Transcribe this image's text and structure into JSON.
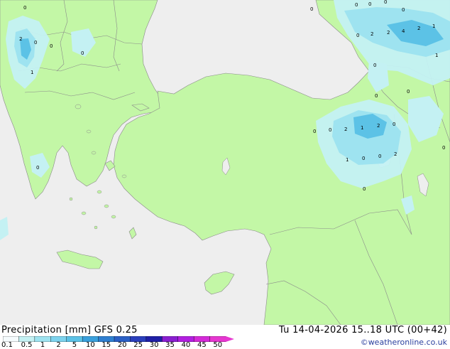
{
  "map": {
    "colors": {
      "sea": "#eeeeee",
      "land": "#c3f7a6",
      "border": "#8a8a8a",
      "precip_light": "#c4f1f3",
      "precip_mid": "#9ee3f0",
      "precip_heavy": "#5cc2e6"
    },
    "value_labels": [
      {
        "id": "v1",
        "text": "0"
      },
      {
        "id": "v2",
        "text": "2"
      },
      {
        "id": "v3",
        "text": "0"
      },
      {
        "id": "v4",
        "text": "0"
      },
      {
        "id": "v5",
        "text": "1"
      },
      {
        "id": "v6",
        "text": "0"
      },
      {
        "id": "v7",
        "text": "0"
      },
      {
        "id": "v8",
        "text": "0"
      },
      {
        "id": "v9",
        "text": "0"
      },
      {
        "id": "v10",
        "text": "0"
      },
      {
        "id": "v11",
        "text": "0"
      },
      {
        "id": "v12",
        "text": "0"
      },
      {
        "id": "v13",
        "text": "0"
      },
      {
        "id": "v14",
        "text": "2"
      },
      {
        "id": "v15",
        "text": "2"
      },
      {
        "id": "v16",
        "text": "4"
      },
      {
        "id": "v17",
        "text": "2"
      },
      {
        "id": "v18",
        "text": "1"
      },
      {
        "id": "v19",
        "text": "1"
      },
      {
        "id": "v20",
        "text": "0"
      },
      {
        "id": "v21",
        "text": "0"
      },
      {
        "id": "v22",
        "text": "0"
      },
      {
        "id": "v23",
        "text": "0"
      },
      {
        "id": "v24",
        "text": "0"
      },
      {
        "id": "v25",
        "text": "2"
      },
      {
        "id": "v26",
        "text": "1"
      },
      {
        "id": "v27",
        "text": "2"
      },
      {
        "id": "v28",
        "text": "0"
      },
      {
        "id": "v29",
        "text": "1"
      },
      {
        "id": "v30",
        "text": "0"
      },
      {
        "id": "v31",
        "text": "0"
      },
      {
        "id": "v32",
        "text": "2"
      },
      {
        "id": "v33",
        "text": "0"
      },
      {
        "id": "v34",
        "text": "0"
      }
    ]
  },
  "footer": {
    "title": "Precipitation [mm]  GFS 0.25",
    "datetime": "Tu 14-04-2026 15..18 UTC (00+42)",
    "credit": "©weatheronline.co.uk"
  },
  "legend": {
    "labels": [
      "0.1",
      "0.5",
      "1",
      "2",
      "5",
      "10",
      "15",
      "20",
      "25",
      "30",
      "35",
      "40",
      "45",
      "50"
    ],
    "colors": [
      "#f5fbfd",
      "#c4f1f3",
      "#9ee3f0",
      "#7dd3ee",
      "#5cc2e6",
      "#3aa0dc",
      "#2f7fd0",
      "#2a5fc5",
      "#2a3fbc",
      "#1f1fa6",
      "#8a1fd0",
      "#b21fe0",
      "#d42ad8",
      "#e637d0"
    ]
  }
}
